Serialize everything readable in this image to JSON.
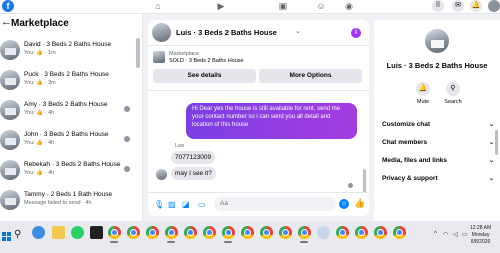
{
  "topbar": {
    "logo": "f",
    "nav_icons": [
      "home-icon",
      "video-icon",
      "marketplace-icon",
      "groups-icon",
      "gaming-icon"
    ],
    "right_icons": [
      "menu-grid-icon",
      "messenger-icon",
      "bell-icon",
      "profile-icon"
    ]
  },
  "sidebar": {
    "title": "Marketplace",
    "conversations": [
      {
        "name": "David · 3 Beds 2 Baths House",
        "sub": "You: 👍 · 1m"
      },
      {
        "name": "Puck · 3 Beds 2 Baths House",
        "sub": "You: 👍 · 3m"
      },
      {
        "name": "Amy · 3 Beds 2 Baths House",
        "sub": "You: 👍 · 4h"
      },
      {
        "name": "John · 3 Beds 2 Baths House",
        "sub": "You: 👍 · 4h"
      },
      {
        "name": "Rebekah · 3 Beds 2 Baths House",
        "sub": "You: 👍 · 4h"
      },
      {
        "name": "Tammy · 2 Beds 1 Bath House",
        "sub": "Message failed to send · 4h"
      }
    ]
  },
  "chat": {
    "title": "Luis · 3 Beds 2 Baths House",
    "marketplace_label": "Marketplace",
    "sold_text": "SOLD · 3 Beds 2 Baths House",
    "see_details": "See details",
    "more_options": "More Options",
    "outgoing_message": "Hi Dear yes the house is still available for rent, send me your contact number so i can send you all detail and location of this house",
    "sender_name": "Luis",
    "incoming_messages": [
      "7077123009",
      "may I see it?"
    ],
    "composer_placeholder": "Aa"
  },
  "right_panel": {
    "name": "Luis · 3 Beds 2 Baths House",
    "actions": [
      {
        "icon": "bell-icon",
        "label": "Mute"
      },
      {
        "icon": "search-icon",
        "label": "Search"
      }
    ],
    "sections": [
      "Customize chat",
      "Chat members",
      "Media, files and links",
      "Privacy & support"
    ]
  },
  "taskbar": {
    "time": "12:28 AM",
    "day": "Monday",
    "date": "8/8/2026"
  },
  "colors": {
    "accent": "#1877f2",
    "outgoing_bubble": "#8e3fe8",
    "messenger_blue": "#0084ff"
  }
}
